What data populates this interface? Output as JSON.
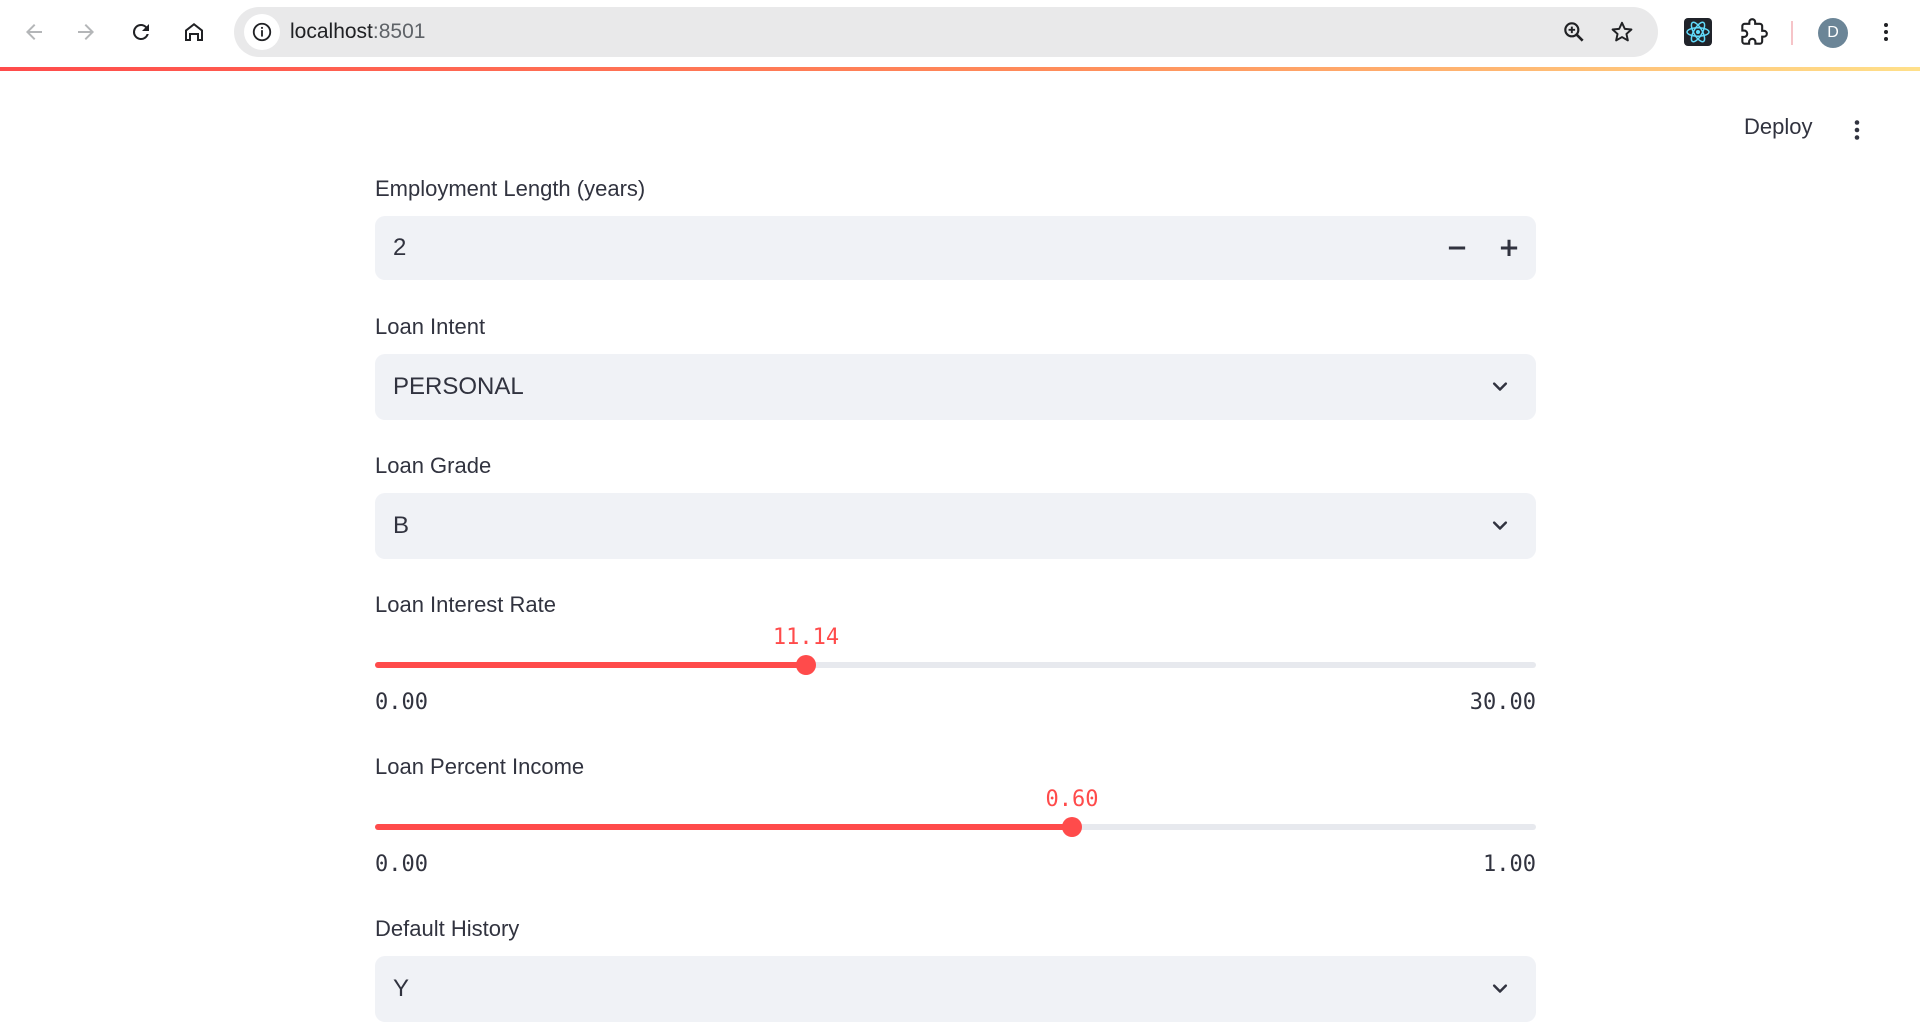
{
  "browser": {
    "url_host": "localhost",
    "url_port": ":8501",
    "profile_initial": "D"
  },
  "header": {
    "deploy_label": "Deploy"
  },
  "form": {
    "employment_length": {
      "label": "Employment Length (years)",
      "value": "2",
      "minus": "−",
      "plus": "+"
    },
    "loan_intent": {
      "label": "Loan Intent",
      "value": "PERSONAL"
    },
    "loan_grade": {
      "label": "Loan Grade",
      "value": "B"
    },
    "loan_interest_rate": {
      "label": "Loan Interest Rate",
      "value": "11.14",
      "min": "0.00",
      "max": "30.00",
      "fraction": 0.3713
    },
    "loan_percent_income": {
      "label": "Loan Percent Income",
      "value": "0.60",
      "min": "0.00",
      "max": "1.00",
      "fraction": 0.6
    },
    "default_history": {
      "label": "Default History",
      "value": "Y"
    }
  },
  "colors": {
    "accent": "#ff4b4b",
    "text": "#31333f",
    "field_bg": "#f0f2f6"
  },
  "icons": [
    "back-icon",
    "forward-icon",
    "reload-icon",
    "home-icon",
    "info-icon",
    "zoom-icon",
    "star-icon",
    "react-devtools-icon",
    "extensions-icon",
    "menu-icon",
    "chevron-down-icon"
  ]
}
